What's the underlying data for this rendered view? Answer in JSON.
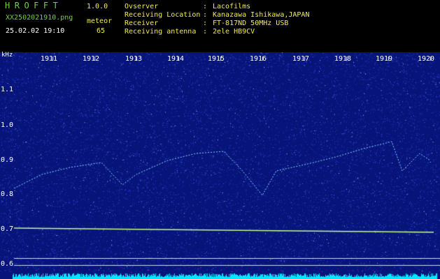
{
  "header": {
    "title": "HROFFT",
    "version": "1.0.0",
    "filename": "XX2502021910.png",
    "meteor_label": "meteor",
    "datetime": "25.02.02 19:10",
    "meteor_count": "65",
    "info": [
      {
        "label": "Ovserver",
        "value": "Lacofilms"
      },
      {
        "label": "Receiving Location",
        "value": "Kanazawa Ishikawa,JAPAN"
      },
      {
        "label": "Receiver",
        "value": "FT-817ND 50MHz USB"
      },
      {
        "label": "Receiving antenna",
        "value": "2ele HB9CV"
      }
    ]
  },
  "spectrogram": {
    "unit": "kHz",
    "y_ticks": [
      "1.1",
      "1.0",
      "0.9",
      "0.8",
      "0.7",
      "0.6"
    ],
    "x_ticks": [
      "1911",
      "1912",
      "1913",
      "1914",
      "1915",
      "1916",
      "1917",
      "1918",
      "1919",
      "1920"
    ],
    "colors": {
      "background": "#07147a",
      "noise": "#4a64ff",
      "trace": "#7fe0ff",
      "baseline": "#c8ff8a",
      "bottom_bar": "#00e6ff"
    }
  }
}
